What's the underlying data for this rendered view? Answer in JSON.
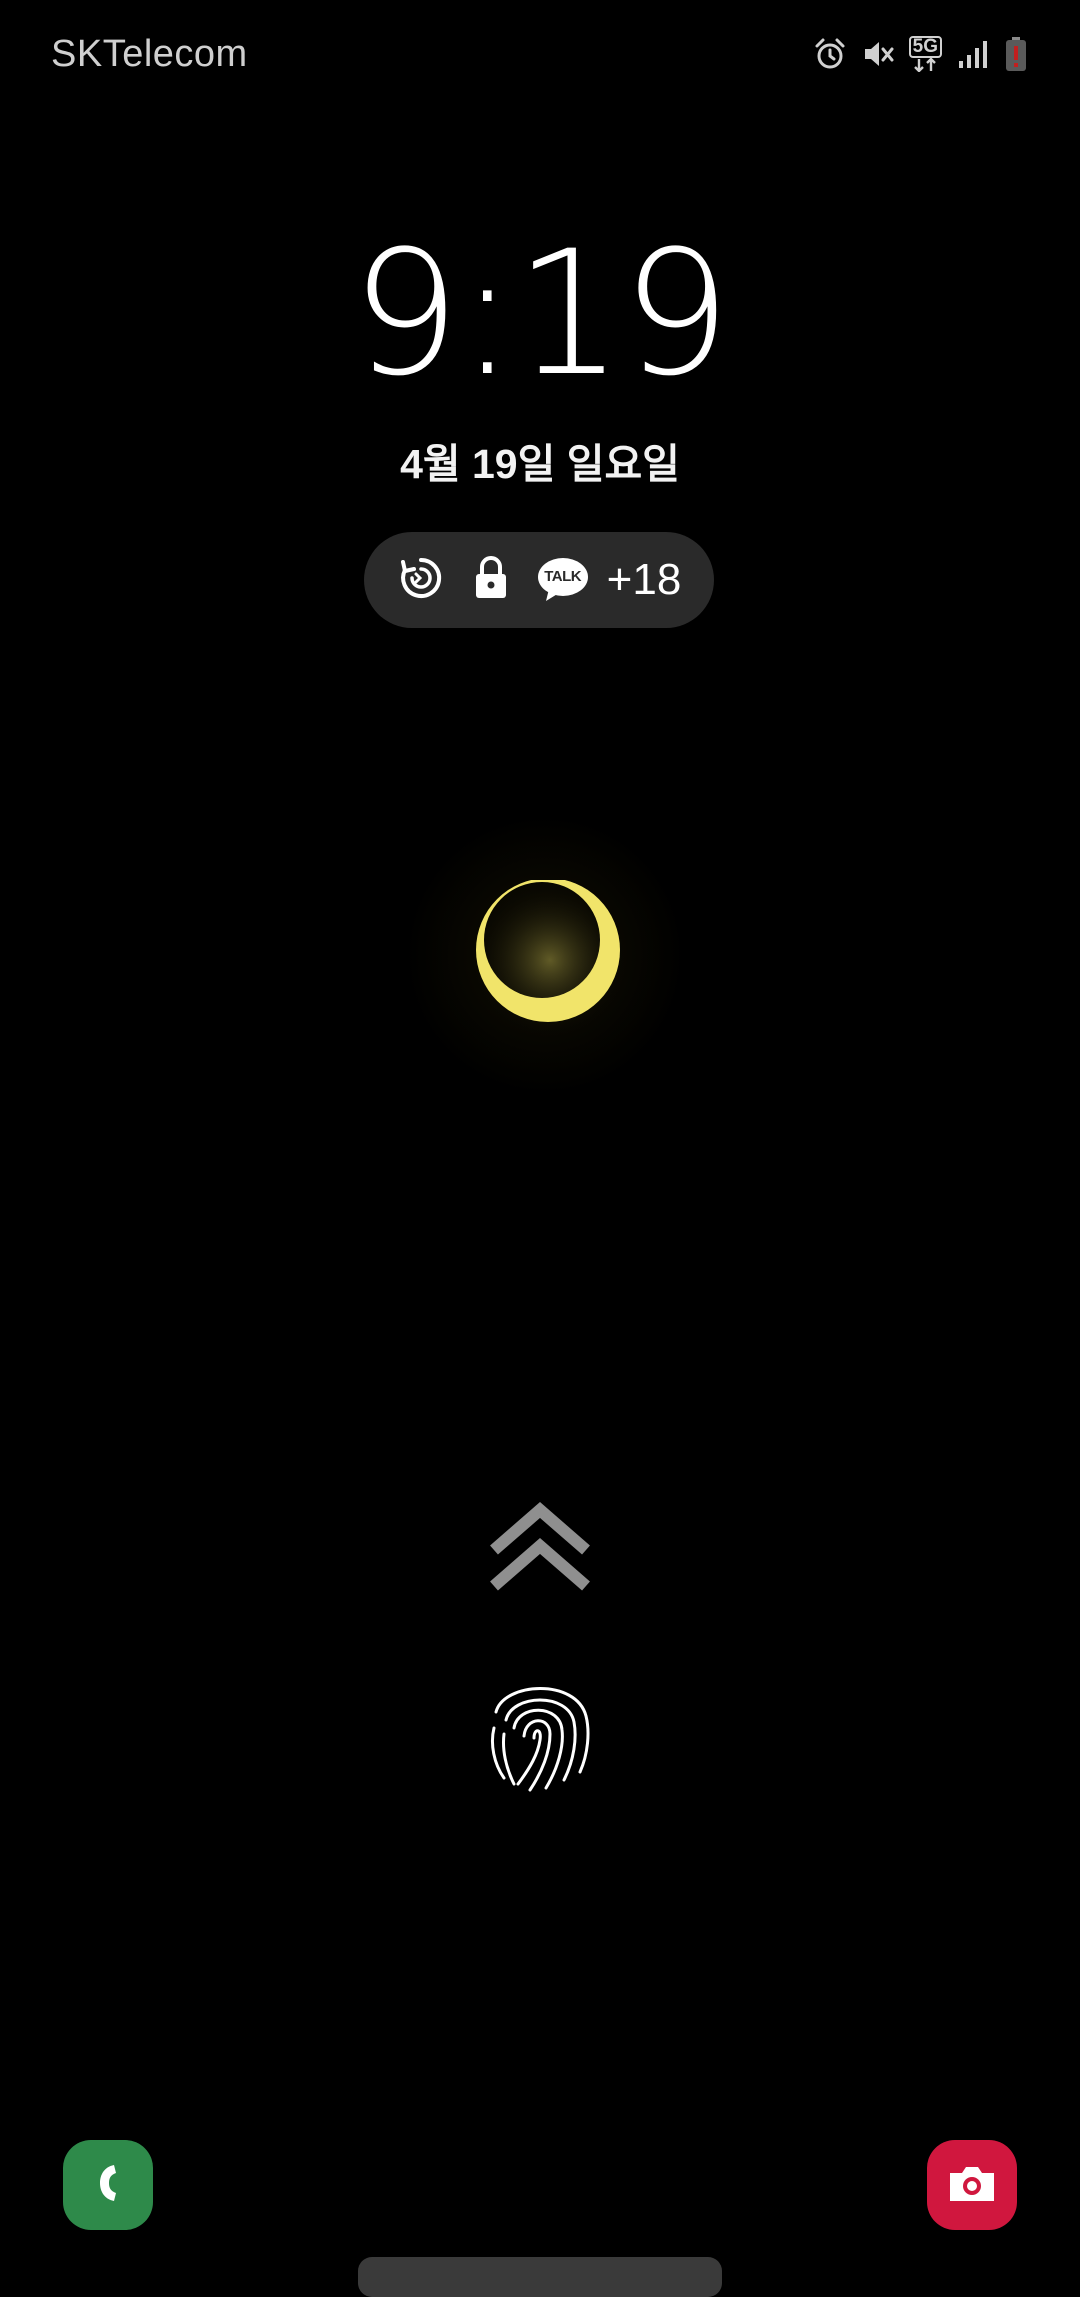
{
  "status_bar": {
    "carrier": "SKTelecom",
    "network_type": "5G",
    "icons": [
      "alarm-icon",
      "mute-icon",
      "5g-data-icon",
      "signal-icon",
      "battery-low-icon"
    ]
  },
  "lock_screen": {
    "time": "9:19",
    "date": "4월 19일 일요일",
    "notifications": {
      "icons": [
        "sync-icon",
        "lock-icon",
        "kakaotalk-icon"
      ],
      "talk_label": "TALK",
      "more_count": "+18"
    }
  },
  "shortcuts": {
    "left": "phone-icon",
    "right": "camera-icon"
  },
  "colors": {
    "background": "#000000",
    "moon": "#f4e86a",
    "phone": "#2e8a4a",
    "camera": "#d0173e",
    "pill": "#2a2a2a"
  }
}
